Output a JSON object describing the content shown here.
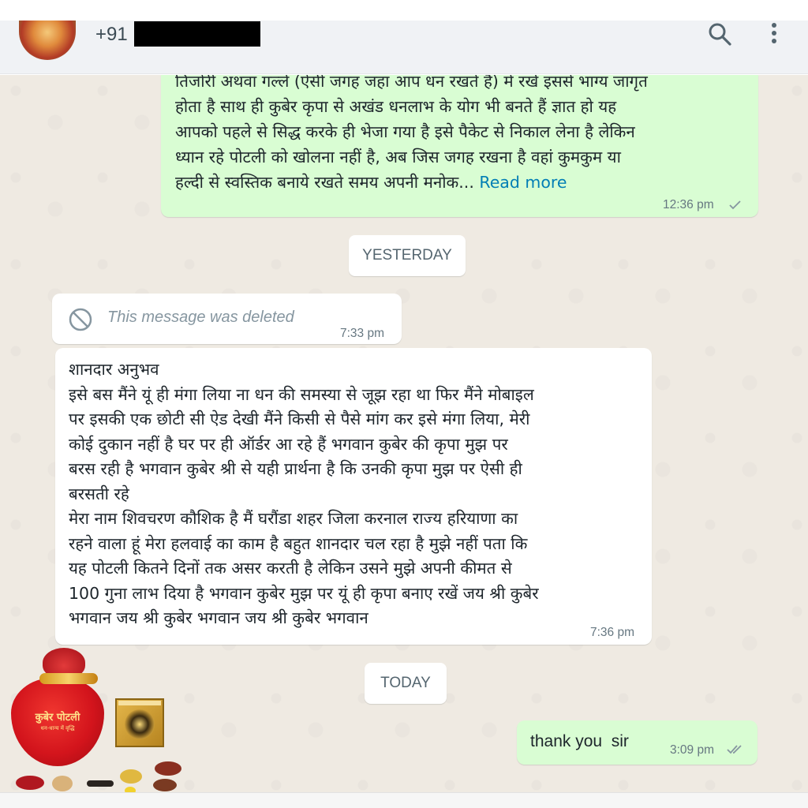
{
  "header": {
    "contact_prefix": "+91",
    "icons": [
      "search-icon",
      "more-vertical-icon"
    ]
  },
  "messages": {
    "first": {
      "text": "तिजोरी अथवा गल्ले (ऐसी जगह जहा आप धन रखते है) में रखें इससे भाग्य जागृत\nहोता है साथ ही कुबेर कृपा से अखंड धनलाभ के योग भी बनते हैं ज्ञात हो यह\nआपको पहले से सिद्ध करके ही भेजा गया है इसे पैकेट से निकाल लेना है लेकिन\nध्यान रहे पोटली को खोलना नहीं है, अब जिस जगह रखना है वहां कुमकुम या\nहल्दी से स्वस्तिक बनाये रखते समय अपनी मनोक...",
      "read_more": "Read more",
      "time": "12:36 pm"
    },
    "date_yesterday": "YESTERDAY",
    "deleted": {
      "text": "This message was deleted",
      "time": "7:33 pm"
    },
    "review": {
      "text": "शानदार अनुभव\nइसे बस मैंने यूं ही मंगा लिया ना धन की समस्या से जूझ रहा था फिर मैंने मोबाइल\nपर इसकी एक छोटी सी ऐड देखी मैंने किसी से पैसे मांग कर इसे मंगा लिया, मेरी\nकोई दुकान नहीं है घर पर ही ऑर्डर आ रहे हैं भगवान कुबेर की कृपा मुझ पर\nबरस रही है भगवान कुबेर श्री से यही प्रार्थना है कि उनकी कृपा मुझ पर ऐसी ही\nबरसती रहे\nमेरा नाम शिवचरण कौशिक है मैं घरौंडा शहर जिला करनाल राज्य हरियाणा का\nरहने वाला हूं मेरा हलवाई का काम है बहुत शानदार चल रहा है मुझे नहीं पता कि\nयह पोटली कितने दिनों तक असर करती है लेकिन उसने मुझे अपनी कीमत से\n100 गुना लाभ दिया है भगवान कुबेर मुझ पर यूं ही कृपा बनाए रखें जय श्री कुबेर\nभगवान जय श्री कुबेर भगवान जय श्री कुबेर भगवान",
      "time": "7:36 pm"
    },
    "date_today": "TODAY",
    "reply": {
      "text": "thank you  sir",
      "time": "3:09 pm"
    }
  },
  "product": {
    "label_title": "कुबेर पोटली",
    "label_sub": "धन-धान्य में वृद्धि"
  },
  "colors": {
    "outgoing_bubble": "#d9fdd3",
    "incoming_bubble": "#ffffff",
    "chat_background": "#efeae2",
    "link": "#027eb5",
    "read_ticks": "#53bdeb"
  }
}
